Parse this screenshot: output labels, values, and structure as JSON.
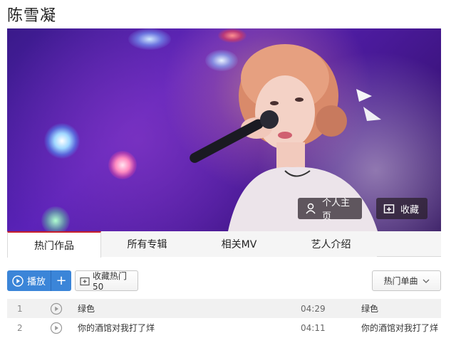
{
  "artist": {
    "name": "陈雪凝"
  },
  "banner": {
    "home_label": "个人主页",
    "fav_label": "收藏",
    "home_icon": "user-icon",
    "fav_icon": "folder-plus-icon"
  },
  "tabs": [
    {
      "label": "热门作品",
      "active": true
    },
    {
      "label": "所有专辑",
      "active": false
    },
    {
      "label": "相关MV",
      "active": false
    },
    {
      "label": "艺人介绍",
      "active": false
    }
  ],
  "toolbar": {
    "play_label": "播放",
    "add_label": "+",
    "collect_label": "收藏热门50",
    "sort_label": "热门单曲"
  },
  "songs": [
    {
      "index": "1",
      "title": "绿色",
      "duration": "04:29",
      "album": "绿色"
    },
    {
      "index": "2",
      "title": "你的酒馆对我打了烊",
      "duration": "04:11",
      "album": "你的酒馆对我打了烊"
    }
  ],
  "colors": {
    "accent": "#3b85d8",
    "tab_active": "#c8202b"
  }
}
